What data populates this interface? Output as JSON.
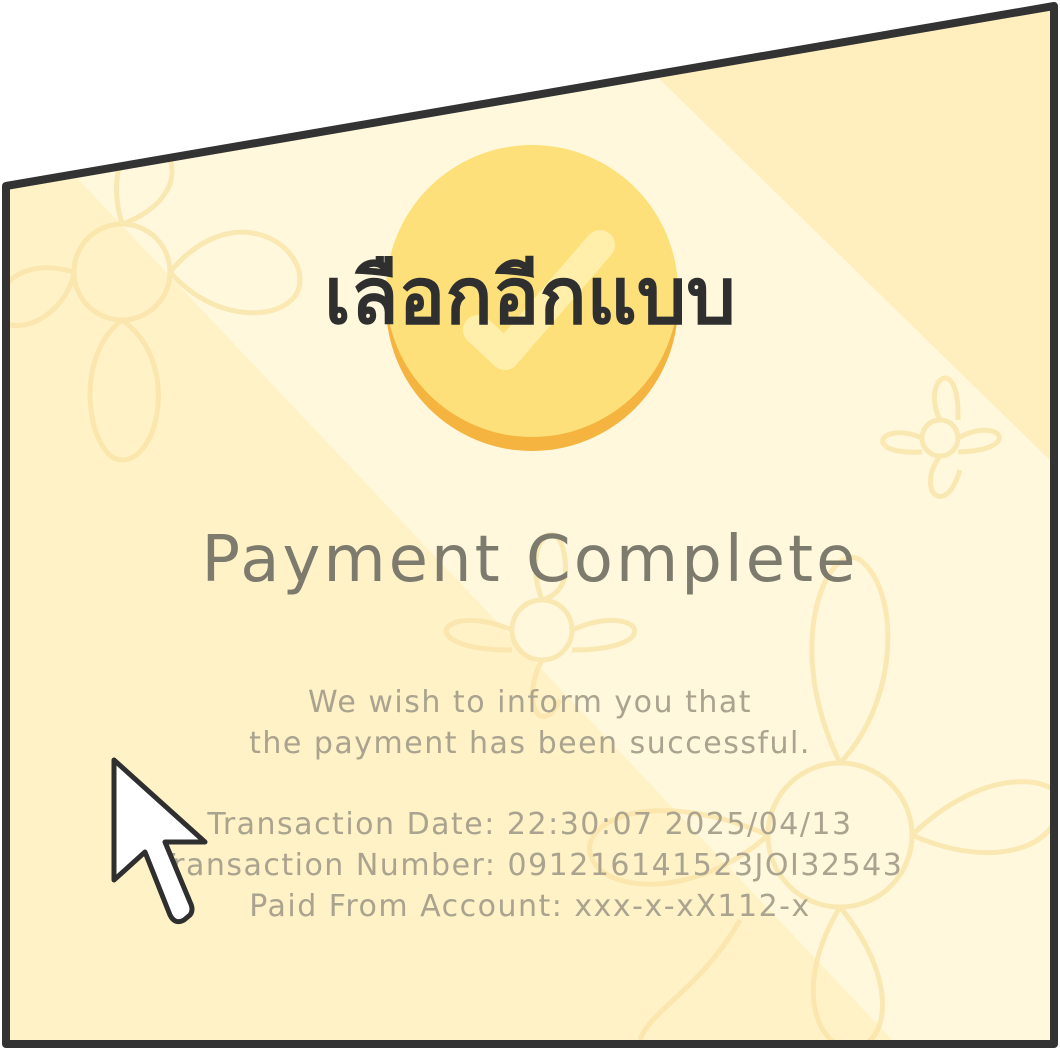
{
  "colors": {
    "panel_fill": "#fff3c4",
    "panel_light": "#fff8dc",
    "panel_border": "#333333",
    "check_badge": "#fde07a",
    "check_badge_shadow": "#f4b43f",
    "title_text": "#2f2f2f",
    "heading_text": "#7d7a6e",
    "body_text": "#aaa38f"
  },
  "icons": {
    "badge": "check-badge-icon",
    "pattern": "flower-pattern-icon",
    "pointer": "mouse-cursor-icon"
  },
  "thai_title": "เลือกอีกแบบ",
  "payment_title": "Payment Complete",
  "message": {
    "line1": "We wish to inform you that",
    "line2": "the payment has been successful."
  },
  "details": {
    "date": "Transaction Date: 22:30:07   2025/04/13",
    "number": "Transaction Number: 091216141523JOI32543",
    "account": "Paid From Account: xxx-x-xX112-x"
  }
}
